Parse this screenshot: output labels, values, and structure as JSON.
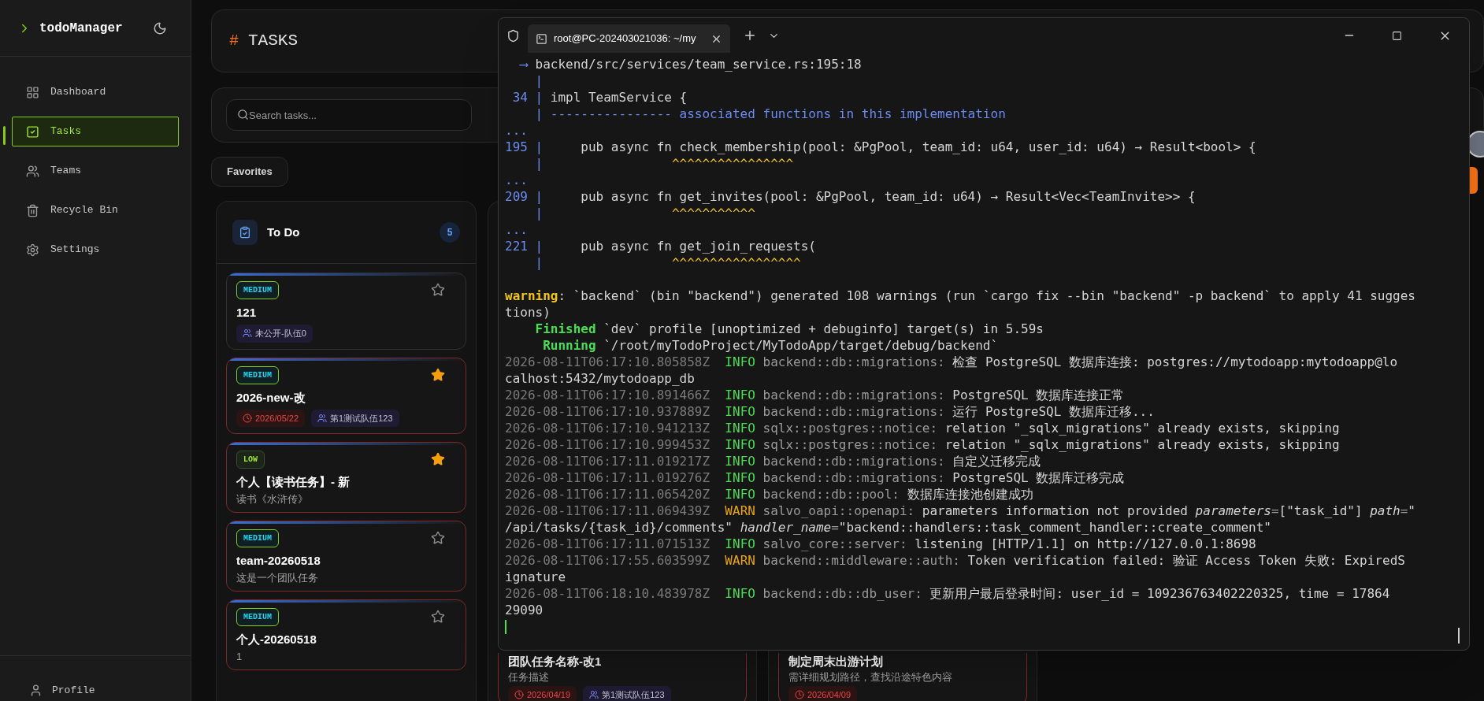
{
  "sidebar": {
    "brand": "todoManager",
    "items": [
      {
        "label": "Dashboard",
        "selected": false
      },
      {
        "label": "Tasks",
        "selected": true
      },
      {
        "label": "Teams",
        "selected": false
      },
      {
        "label": "Recycle Bin",
        "selected": false
      },
      {
        "label": "Settings",
        "selected": false
      }
    ],
    "profile": "Profile"
  },
  "header": {
    "mark": "#",
    "title": "TASKS"
  },
  "search": {
    "placeholder": "Search tasks..."
  },
  "favorites": "Favorites",
  "columns": [
    {
      "title": "To Do",
      "count": "5",
      "cards": [
        {
          "priority": "MEDIUM",
          "kind": "medium",
          "title": "121",
          "favorite": false,
          "overdue": false,
          "chips": [
            {
              "kind": "team",
              "text": "未公开-队伍0"
            }
          ]
        },
        {
          "priority": "MEDIUM",
          "kind": "medium",
          "title": "2026-new-改",
          "favorite": true,
          "overdue": true,
          "chips": [
            {
              "kind": "date",
              "text": "2026/05/22"
            },
            {
              "kind": "team",
              "text": "第1测试队伍123"
            }
          ]
        },
        {
          "priority": "LOW",
          "kind": "low",
          "title": "个人【读书任务】- 新",
          "description": "读书《水浒传》",
          "favorite": true,
          "overdue": true
        },
        {
          "priority": "MEDIUM",
          "kind": "medium",
          "title": "team-20260518",
          "description": "这是一个团队任务",
          "favorite": false,
          "overdue": true
        },
        {
          "priority": "MEDIUM",
          "kind": "medium",
          "title": "个人-20260518",
          "description": "1",
          "favorite": false,
          "overdue": true
        }
      ]
    },
    {
      "cards": [
        {
          "title": "团队任务名称-改1",
          "description": "任务描述",
          "overdue": true,
          "chips": [
            {
              "kind": "date",
              "text": "2026/04/19"
            },
            {
              "kind": "team",
              "text": "第1测试队伍123"
            }
          ]
        }
      ]
    },
    {
      "cards": [
        {
          "title": "制定周末出游计划",
          "description": "需详细规划路径，查找沿途特色内容",
          "overdue": true,
          "chips": [
            {
              "kind": "date",
              "text": "2026/04/09"
            }
          ]
        }
      ]
    }
  ],
  "terminal": {
    "tab_title": "root@PC-202403021036: ~/my",
    "lines": [
      {
        "segments": [
          {
            "kind": "gutter",
            "text": "  ⟶ "
          },
          {
            "kind": "plain",
            "text": "backend/src/services/team_service.rs:195:18"
          }
        ]
      },
      {
        "segments": [
          {
            "kind": "gutter",
            "text": "    |"
          }
        ]
      },
      {
        "segments": [
          {
            "kind": "gutter",
            "text": " 34 | "
          },
          {
            "kind": "plain",
            "text": "impl TeamService {"
          }
        ]
      },
      {
        "segments": [
          {
            "kind": "gutter",
            "text": "    | ---------------- associated functions in this implementation"
          }
        ]
      },
      {
        "segments": [
          {
            "kind": "gutter",
            "text": "..."
          }
        ]
      },
      {
        "segments": [
          {
            "kind": "gutter",
            "text": "195 | "
          },
          {
            "kind": "plain",
            "text": "    pub async fn check_membership(pool: &PgPool, team_id: u64, user_id: u64) → Result<bool> {"
          }
        ]
      },
      {
        "segments": [
          {
            "kind": "gutter",
            "text": "    | "
          },
          {
            "kind": "caret",
            "text": "                ^^^^^^^^^^^^^^^^"
          }
        ]
      },
      {
        "segments": [
          {
            "kind": "gutter",
            "text": "..."
          }
        ]
      },
      {
        "segments": [
          {
            "kind": "gutter",
            "text": "209 | "
          },
          {
            "kind": "plain",
            "text": "    pub async fn get_invites(pool: &PgPool, team_id: u64) → Result<Vec<TeamInvite>> {"
          }
        ]
      },
      {
        "segments": [
          {
            "kind": "gutter",
            "text": "    | "
          },
          {
            "kind": "caret",
            "text": "                ^^^^^^^^^^^"
          }
        ]
      },
      {
        "segments": [
          {
            "kind": "gutter",
            "text": "..."
          }
        ]
      },
      {
        "segments": [
          {
            "kind": "gutter",
            "text": "221 | "
          },
          {
            "kind": "plain",
            "text": "    pub async fn get_join_requests("
          }
        ]
      },
      {
        "segments": [
          {
            "kind": "gutter",
            "text": "    | "
          },
          {
            "kind": "caret",
            "text": "                ^^^^^^^^^^^^^^^^^"
          }
        ]
      },
      {
        "segments": [
          {
            "kind": "warning",
            "text": "warning"
          },
          {
            "kind": "plain",
            "text": ": `backend` (bin \"backend\") generated 108 warnings (run `cargo fix --bin \"backend\" -p backend` to apply 41 sugges"
          }
        ]
      },
      {
        "segments": [
          {
            "kind": "plain",
            "text": "tions)"
          }
        ]
      },
      {
        "segments": [
          {
            "kind": "success",
            "text": "    Finished"
          },
          {
            "kind": "plain",
            "text": " `dev` profile [unoptimized + debuginfo] target(s) in 5.59s"
          }
        ]
      },
      {
        "segments": [
          {
            "kind": "success",
            "text": "     Running"
          },
          {
            "kind": "plain",
            "text": " `/root/myTodoProject/MyTodoApp/target/debug/backend`"
          }
        ]
      },
      {
        "segments": [
          {
            "kind": "time",
            "text": "2026-08-11T06:17:10.805858Z"
          },
          {
            "kind": "info",
            "text": "  INFO "
          },
          {
            "kind": "module",
            "text": "backend::db::migrations:"
          },
          {
            "kind": "plain",
            "text": " 检查 PostgreSQL 数据库连接: postgres://mytodoapp:mytodoapp@lo"
          }
        ]
      },
      {
        "segments": [
          {
            "kind": "plain",
            "text": "calhost:5432/mytodoapp_db"
          }
        ]
      },
      {
        "segments": [
          {
            "kind": "time",
            "text": "2026-08-11T06:17:10.891466Z"
          },
          {
            "kind": "info",
            "text": "  INFO "
          },
          {
            "kind": "module",
            "text": "backend::db::migrations:"
          },
          {
            "kind": "plain",
            "text": " PostgreSQL 数据库连接正常"
          }
        ]
      },
      {
        "segments": [
          {
            "kind": "time",
            "text": "2026-08-11T06:17:10.937889Z"
          },
          {
            "kind": "info",
            "text": "  INFO "
          },
          {
            "kind": "module",
            "text": "backend::db::migrations:"
          },
          {
            "kind": "plain",
            "text": " 运行 PostgreSQL 数据库迁移..."
          }
        ]
      },
      {
        "segments": [
          {
            "kind": "time",
            "text": "2026-08-11T06:17:10.941213Z"
          },
          {
            "kind": "info",
            "text": "  INFO "
          },
          {
            "kind": "module",
            "text": "sqlx::postgres::notice:"
          },
          {
            "kind": "plain",
            "text": " relation \"_sqlx_migrations\" already exists, skipping"
          }
        ]
      },
      {
        "segments": [
          {
            "kind": "time",
            "text": "2026-08-11T06:17:10.999453Z"
          },
          {
            "kind": "info",
            "text": "  INFO "
          },
          {
            "kind": "module",
            "text": "sqlx::postgres::notice:"
          },
          {
            "kind": "plain",
            "text": " relation \"_sqlx_migrations\" already exists, skipping"
          }
        ]
      },
      {
        "segments": [
          {
            "kind": "time",
            "text": "2026-08-11T06:17:11.019217Z"
          },
          {
            "kind": "info",
            "text": "  INFO "
          },
          {
            "kind": "module",
            "text": "backend::db::migrations:"
          },
          {
            "kind": "plain",
            "text": " 自定义迁移完成"
          }
        ]
      },
      {
        "segments": [
          {
            "kind": "time",
            "text": "2026-08-11T06:17:11.019276Z"
          },
          {
            "kind": "info",
            "text": "  INFO "
          },
          {
            "kind": "module",
            "text": "backend::db::migrations:"
          },
          {
            "kind": "plain",
            "text": " PostgreSQL 数据库迁移完成"
          }
        ]
      },
      {
        "segments": [
          {
            "kind": "time",
            "text": "2026-08-11T06:17:11.065420Z"
          },
          {
            "kind": "info",
            "text": "  INFO "
          },
          {
            "kind": "module",
            "text": "backend::db::pool:"
          },
          {
            "kind": "plain",
            "text": " 数据库连接池创建成功"
          }
        ]
      },
      {
        "segments": [
          {
            "kind": "time",
            "text": "2026-08-11T06:17:11.069439Z"
          },
          {
            "kind": "warn",
            "text": "  WARN "
          },
          {
            "kind": "module",
            "text": "salvo_oapi::openapi:"
          },
          {
            "kind": "plain",
            "text": " parameters information not provided "
          },
          {
            "kind": "field",
            "text": "parameters"
          },
          {
            "kind": "module",
            "text": "="
          },
          {
            "kind": "plain",
            "text": "[\"task_id\"] "
          },
          {
            "kind": "field",
            "text": "path"
          },
          {
            "kind": "module",
            "text": "="
          },
          {
            "kind": "plain",
            "text": "\""
          }
        ]
      },
      {
        "segments": [
          {
            "kind": "plain",
            "text": "/api/tasks/{task_id}/comments\" "
          },
          {
            "kind": "field",
            "text": "handler_name"
          },
          {
            "kind": "module",
            "text": "="
          },
          {
            "kind": "plain",
            "text": "\"backend::handlers::task_comment_handler::create_comment\""
          }
        ]
      },
      {
        "segments": [
          {
            "kind": "time",
            "text": "2026-08-11T06:17:11.071513Z"
          },
          {
            "kind": "info",
            "text": "  INFO "
          },
          {
            "kind": "module",
            "text": "salvo_core::server:"
          },
          {
            "kind": "plain",
            "text": " listening [HTTP/1.1] on http://127.0.0.1:8698"
          }
        ]
      },
      {
        "segments": [
          {
            "kind": "time",
            "text": "2026-08-11T06:17:55.603599Z"
          },
          {
            "kind": "warn",
            "text": "  WARN "
          },
          {
            "kind": "module",
            "text": "backend::middleware::auth:"
          },
          {
            "kind": "plain",
            "text": " Token verification failed: 验证 Access Token 失败: ExpiredS"
          }
        ]
      },
      {
        "segments": [
          {
            "kind": "plain",
            "text": "ignature"
          }
        ]
      },
      {
        "segments": [
          {
            "kind": "time",
            "text": "2026-08-11T06:18:10.483978Z"
          },
          {
            "kind": "info",
            "text": "  INFO "
          },
          {
            "kind": "module",
            "text": "backend::db::db_user:"
          },
          {
            "kind": "plain",
            "text": " 更新用户最后登录时间: user_id = 109236763402220325, time = 17864"
          }
        ]
      },
      {
        "segments": [
          {
            "kind": "plain",
            "text": "29090"
          }
        ]
      }
    ]
  }
}
